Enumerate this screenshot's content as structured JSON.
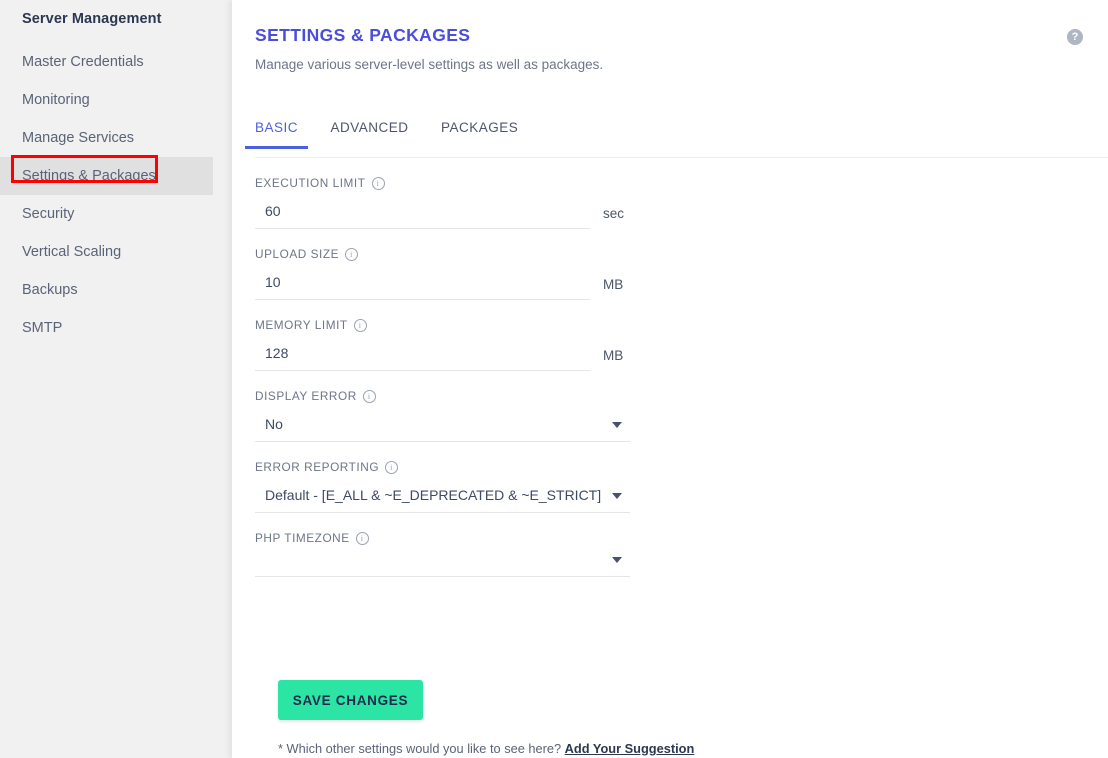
{
  "sidebar": {
    "title": "Server Management",
    "items": [
      {
        "label": "Master Credentials",
        "active": false
      },
      {
        "label": "Monitoring",
        "active": false
      },
      {
        "label": "Manage Services",
        "active": false
      },
      {
        "label": "Settings & Packages",
        "active": true
      },
      {
        "label": "Security",
        "active": false
      },
      {
        "label": "Vertical Scaling",
        "active": false
      },
      {
        "label": "Backups",
        "active": false
      },
      {
        "label": "SMTP",
        "active": false
      }
    ],
    "highlight_color": "#fe0000"
  },
  "header": {
    "title": "SETTINGS & PACKAGES",
    "subtitle": "Manage various server-level settings as well as packages.",
    "title_color": "#4b4ddb",
    "help_icon": "help-question-icon",
    "help_glyph": "?"
  },
  "tabs": [
    {
      "label": "BASIC",
      "active": true
    },
    {
      "label": "ADVANCED",
      "active": false
    },
    {
      "label": "PACKAGES",
      "active": false
    }
  ],
  "form": {
    "execution_limit": {
      "label": "EXECUTION LIMIT",
      "value": "60",
      "placeholder": "",
      "unit": "sec"
    },
    "upload_size": {
      "label": "UPLOAD SIZE",
      "value": "10",
      "placeholder": "",
      "unit": "MB"
    },
    "memory_limit": {
      "label": "MEMORY LIMIT",
      "value": "128",
      "placeholder": "",
      "unit": "MB"
    },
    "display_error": {
      "label": "DISPLAY ERROR",
      "value": "No"
    },
    "error_reporting": {
      "label": "ERROR REPORTING",
      "value": "Default - [E_ALL & ~E_DEPRECATED & ~E_STRICT]"
    },
    "php_timezone": {
      "label": "PHP TIMEZONE",
      "value": ""
    },
    "info_glyph": "i"
  },
  "actions": {
    "save_label": "SAVE CHANGES",
    "save_color": "#2ce5a5"
  },
  "footer": {
    "note": "* Which other settings would you like to see here? ",
    "link": "Add Your Suggestion"
  }
}
